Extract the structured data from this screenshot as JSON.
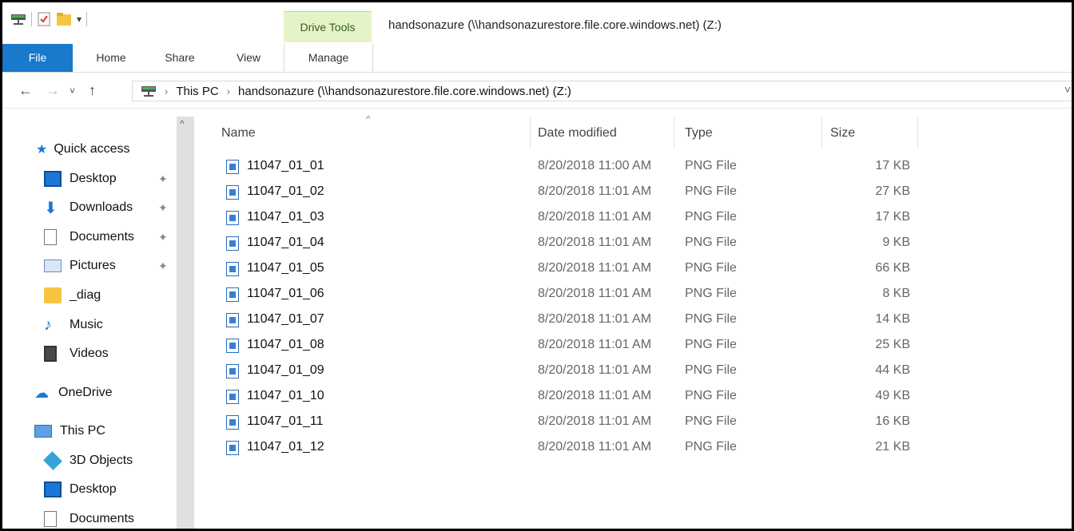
{
  "window": {
    "title": "handsonazure (\\\\handsonazurestore.file.core.windows.net) (Z:)",
    "context_tab": "Drive Tools"
  },
  "ribbon": {
    "tabs": [
      "File",
      "Home",
      "Share",
      "View",
      "Manage"
    ]
  },
  "address": {
    "crumbs": [
      "This PC",
      "handsonazure (\\\\handsonazurestore.file.core.windows.net) (Z:)"
    ]
  },
  "nav": {
    "quick_access": "Quick access",
    "items": [
      {
        "label": "Desktop",
        "icon": "desktop-icon",
        "pinned": true
      },
      {
        "label": "Downloads",
        "icon": "downloads-icon",
        "pinned": true
      },
      {
        "label": "Documents",
        "icon": "documents-icon",
        "pinned": true
      },
      {
        "label": "Pictures",
        "icon": "pictures-icon",
        "pinned": true
      },
      {
        "label": "_diag",
        "icon": "folder-icon",
        "pinned": false
      },
      {
        "label": "Music",
        "icon": "music-icon",
        "pinned": false
      },
      {
        "label": "Videos",
        "icon": "videos-icon",
        "pinned": false
      }
    ],
    "onedrive": "OneDrive",
    "this_pc": "This PC",
    "pc_items": [
      {
        "label": "3D Objects",
        "icon": "3d-objects-icon"
      },
      {
        "label": "Desktop",
        "icon": "desktop-icon"
      },
      {
        "label": "Documents",
        "icon": "documents-icon"
      }
    ]
  },
  "list": {
    "columns": {
      "name": "Name",
      "date": "Date modified",
      "type": "Type",
      "size": "Size"
    },
    "files": [
      {
        "name": "11047_01_01",
        "date": "8/20/2018 11:00 AM",
        "type": "PNG File",
        "size": "17 KB"
      },
      {
        "name": "11047_01_02",
        "date": "8/20/2018 11:01 AM",
        "type": "PNG File",
        "size": "27 KB"
      },
      {
        "name": "11047_01_03",
        "date": "8/20/2018 11:01 AM",
        "type": "PNG File",
        "size": "17 KB"
      },
      {
        "name": "11047_01_04",
        "date": "8/20/2018 11:01 AM",
        "type": "PNG File",
        "size": "9 KB"
      },
      {
        "name": "11047_01_05",
        "date": "8/20/2018 11:01 AM",
        "type": "PNG File",
        "size": "66 KB"
      },
      {
        "name": "11047_01_06",
        "date": "8/20/2018 11:01 AM",
        "type": "PNG File",
        "size": "8 KB"
      },
      {
        "name": "11047_01_07",
        "date": "8/20/2018 11:01 AM",
        "type": "PNG File",
        "size": "14 KB"
      },
      {
        "name": "11047_01_08",
        "date": "8/20/2018 11:01 AM",
        "type": "PNG File",
        "size": "25 KB"
      },
      {
        "name": "11047_01_09",
        "date": "8/20/2018 11:01 AM",
        "type": "PNG File",
        "size": "44 KB"
      },
      {
        "name": "11047_01_10",
        "date": "8/20/2018 11:01 AM",
        "type": "PNG File",
        "size": "49 KB"
      },
      {
        "name": "11047_01_11",
        "date": "8/20/2018 11:01 AM",
        "type": "PNG File",
        "size": "16 KB"
      },
      {
        "name": "11047_01_12",
        "date": "8/20/2018 11:01 AM",
        "type": "PNG File",
        "size": "21 KB"
      }
    ]
  },
  "colors": {
    "file_tab": "#1979ca",
    "context_tab": "#e4f4c7"
  }
}
